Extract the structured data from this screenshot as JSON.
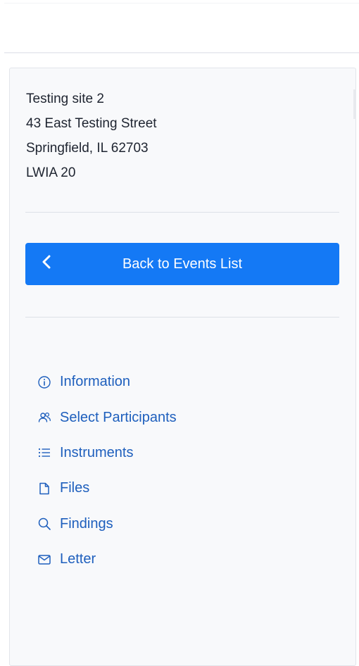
{
  "site": {
    "name": "Testing site 2",
    "street": "43 East Testing Street",
    "city_state_zip": "Springfield, IL 62703",
    "lwia": "LWIA 20"
  },
  "back_button": {
    "label": "Back to Events List",
    "icon": "chevron-left-icon"
  },
  "nav": {
    "items": [
      {
        "label": "Information",
        "icon": "info-circle-icon"
      },
      {
        "label": "Select Participants",
        "icon": "users-icon"
      },
      {
        "label": "Instruments",
        "icon": "list-icon"
      },
      {
        "label": "Files",
        "icon": "file-icon"
      },
      {
        "label": "Findings",
        "icon": "search-icon"
      },
      {
        "label": "Letter",
        "icon": "envelope-icon"
      }
    ]
  },
  "colors": {
    "accent": "#1479f5",
    "link": "#1e5fbd",
    "panel_bg": "#f8f9fb",
    "text": "#1e2430"
  }
}
